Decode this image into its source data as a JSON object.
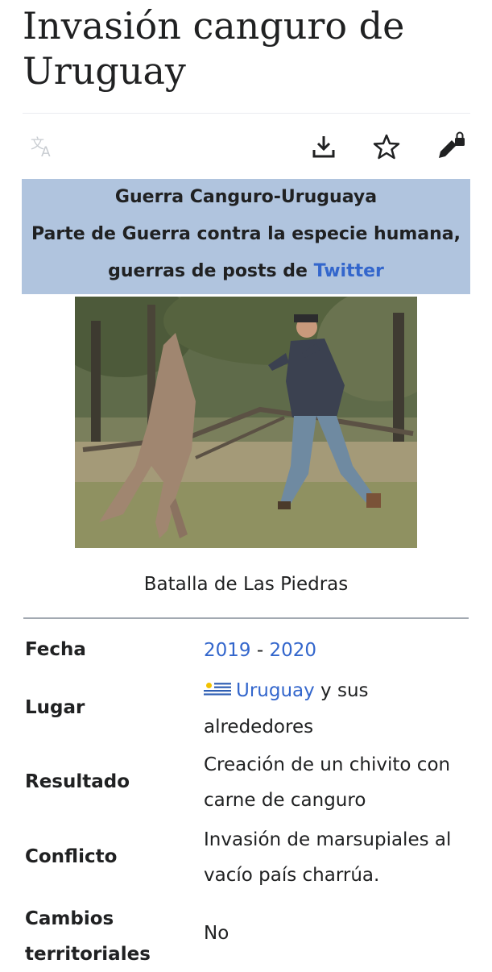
{
  "page": {
    "title_line1": "Invasión canguro de",
    "title_line2": "Uruguay"
  },
  "toolbar": {
    "translate_icon": "language-icon",
    "download_icon": "download-icon",
    "star_icon": "star-icon",
    "edit_icon": "edit-lock-icon"
  },
  "infobox": {
    "heading": "Guerra Canguro-Uruguaya",
    "subheading_line1": "Parte de Guerra contra la especie humana,",
    "subheading_line2_prefix": "guerras de posts de ",
    "subheading_link": "Twitter",
    "header_bg": "#b0c4de",
    "link_color": "#3366cc"
  },
  "image": {
    "caption": "Batalla de Las Piedras"
  },
  "rows": [
    {
      "label": "Fecha",
      "value_link1": "2019",
      "value_sep": " - ",
      "value_link2": "2020"
    },
    {
      "label": "Lugar",
      "value_link": "Uruguay",
      "value_line1_rest": " y sus",
      "value_line2": "alrededores"
    },
    {
      "label": "Resultado",
      "value_line1": "Creación de un chivito con",
      "value_line2": "carne de canguro"
    },
    {
      "label": "Conflicto",
      "value_line1": "Invasión de marsupiales al",
      "value_line2": "vacío país charrúa."
    },
    {
      "label_line1": "Cambios",
      "label_line2": "territoriales",
      "value": "No"
    }
  ]
}
